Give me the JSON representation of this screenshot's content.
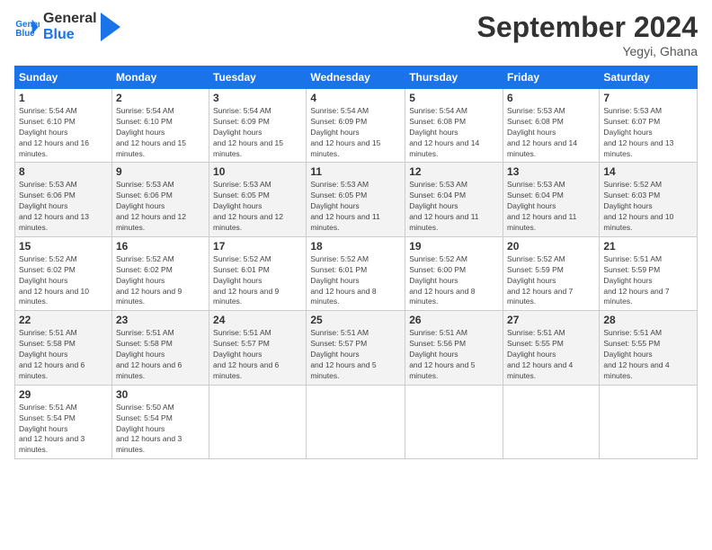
{
  "app": {
    "logo_line1": "General",
    "logo_line2": "Blue"
  },
  "header": {
    "month_year": "September 2024",
    "location": "Yegyi, Ghana"
  },
  "weekdays": [
    "Sunday",
    "Monday",
    "Tuesday",
    "Wednesday",
    "Thursday",
    "Friday",
    "Saturday"
  ],
  "weeks": [
    [
      {
        "day": "1",
        "sunrise": "5:54 AM",
        "sunset": "6:10 PM",
        "daylight": "12 hours and 16 minutes."
      },
      {
        "day": "2",
        "sunrise": "5:54 AM",
        "sunset": "6:10 PM",
        "daylight": "12 hours and 15 minutes."
      },
      {
        "day": "3",
        "sunrise": "5:54 AM",
        "sunset": "6:09 PM",
        "daylight": "12 hours and 15 minutes."
      },
      {
        "day": "4",
        "sunrise": "5:54 AM",
        "sunset": "6:09 PM",
        "daylight": "12 hours and 15 minutes."
      },
      {
        "day": "5",
        "sunrise": "5:54 AM",
        "sunset": "6:08 PM",
        "daylight": "12 hours and 14 minutes."
      },
      {
        "day": "6",
        "sunrise": "5:53 AM",
        "sunset": "6:08 PM",
        "daylight": "12 hours and 14 minutes."
      },
      {
        "day": "7",
        "sunrise": "5:53 AM",
        "sunset": "6:07 PM",
        "daylight": "12 hours and 13 minutes."
      }
    ],
    [
      {
        "day": "8",
        "sunrise": "5:53 AM",
        "sunset": "6:06 PM",
        "daylight": "12 hours and 13 minutes."
      },
      {
        "day": "9",
        "sunrise": "5:53 AM",
        "sunset": "6:06 PM",
        "daylight": "12 hours and 12 minutes."
      },
      {
        "day": "10",
        "sunrise": "5:53 AM",
        "sunset": "6:05 PM",
        "daylight": "12 hours and 12 minutes."
      },
      {
        "day": "11",
        "sunrise": "5:53 AM",
        "sunset": "6:05 PM",
        "daylight": "12 hours and 11 minutes."
      },
      {
        "day": "12",
        "sunrise": "5:53 AM",
        "sunset": "6:04 PM",
        "daylight": "12 hours and 11 minutes."
      },
      {
        "day": "13",
        "sunrise": "5:53 AM",
        "sunset": "6:04 PM",
        "daylight": "12 hours and 11 minutes."
      },
      {
        "day": "14",
        "sunrise": "5:52 AM",
        "sunset": "6:03 PM",
        "daylight": "12 hours and 10 minutes."
      }
    ],
    [
      {
        "day": "15",
        "sunrise": "5:52 AM",
        "sunset": "6:02 PM",
        "daylight": "12 hours and 10 minutes."
      },
      {
        "day": "16",
        "sunrise": "5:52 AM",
        "sunset": "6:02 PM",
        "daylight": "12 hours and 9 minutes."
      },
      {
        "day": "17",
        "sunrise": "5:52 AM",
        "sunset": "6:01 PM",
        "daylight": "12 hours and 9 minutes."
      },
      {
        "day": "18",
        "sunrise": "5:52 AM",
        "sunset": "6:01 PM",
        "daylight": "12 hours and 8 minutes."
      },
      {
        "day": "19",
        "sunrise": "5:52 AM",
        "sunset": "6:00 PM",
        "daylight": "12 hours and 8 minutes."
      },
      {
        "day": "20",
        "sunrise": "5:52 AM",
        "sunset": "5:59 PM",
        "daylight": "12 hours and 7 minutes."
      },
      {
        "day": "21",
        "sunrise": "5:51 AM",
        "sunset": "5:59 PM",
        "daylight": "12 hours and 7 minutes."
      }
    ],
    [
      {
        "day": "22",
        "sunrise": "5:51 AM",
        "sunset": "5:58 PM",
        "daylight": "12 hours and 6 minutes."
      },
      {
        "day": "23",
        "sunrise": "5:51 AM",
        "sunset": "5:58 PM",
        "daylight": "12 hours and 6 minutes."
      },
      {
        "day": "24",
        "sunrise": "5:51 AM",
        "sunset": "5:57 PM",
        "daylight": "12 hours and 6 minutes."
      },
      {
        "day": "25",
        "sunrise": "5:51 AM",
        "sunset": "5:57 PM",
        "daylight": "12 hours and 5 minutes."
      },
      {
        "day": "26",
        "sunrise": "5:51 AM",
        "sunset": "5:56 PM",
        "daylight": "12 hours and 5 minutes."
      },
      {
        "day": "27",
        "sunrise": "5:51 AM",
        "sunset": "5:55 PM",
        "daylight": "12 hours and 4 minutes."
      },
      {
        "day": "28",
        "sunrise": "5:51 AM",
        "sunset": "5:55 PM",
        "daylight": "12 hours and 4 minutes."
      }
    ],
    [
      {
        "day": "29",
        "sunrise": "5:51 AM",
        "sunset": "5:54 PM",
        "daylight": "12 hours and 3 minutes."
      },
      {
        "day": "30",
        "sunrise": "5:50 AM",
        "sunset": "5:54 PM",
        "daylight": "12 hours and 3 minutes."
      },
      null,
      null,
      null,
      null,
      null
    ]
  ]
}
